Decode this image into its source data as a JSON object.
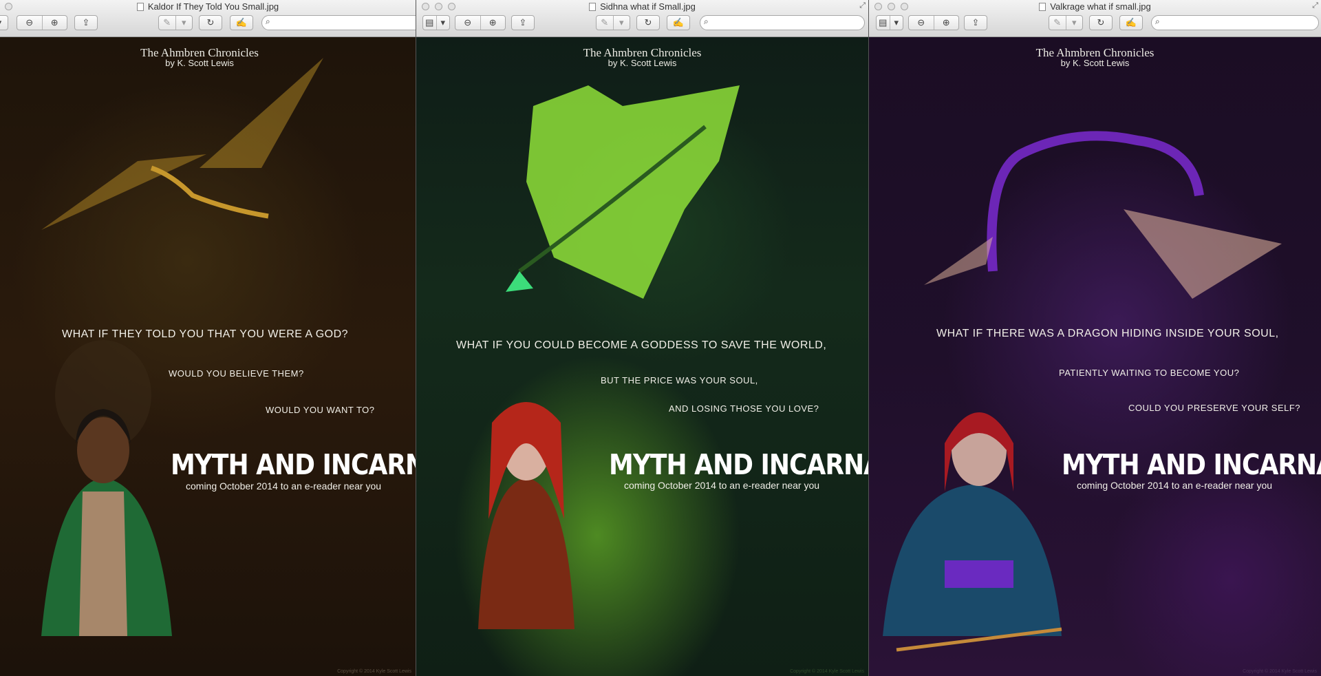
{
  "windows": [
    {
      "title": "Kaldor If They Told You Small.jpg",
      "series": "The Ahmbren Chronicles",
      "author": "by K. Scott Lewis",
      "lines": [
        "WHAT IF THEY TOLD YOU THAT YOU WERE A GOD?",
        "WOULD YOU BELIEVE THEM?",
        "WOULD YOU WANT TO?"
      ],
      "book": "MYTH AND INCARNATION",
      "coming": "coming October 2014 to an e-reader near you",
      "copyright": "Copyright © 2014 Kyle Scott Lewis"
    },
    {
      "title": "Sidhna what if Small.jpg",
      "series": "The Ahmbren Chronicles",
      "author": "by K. Scott Lewis",
      "lines": [
        "WHAT IF YOU COULD BECOME A GODDESS TO SAVE THE WORLD,",
        "BUT THE PRICE WAS YOUR SOUL,",
        "AND LOSING THOSE YOU LOVE?"
      ],
      "book": "MYTH AND INCARNATION",
      "coming": "coming October 2014 to an e-reader near you",
      "copyright": "Copyright © 2014 Kyle Scott Lewis"
    },
    {
      "title": "Valkrage what if small.jpg",
      "series": "The Ahmbren Chronicles",
      "author": "by K. Scott Lewis",
      "lines": [
        "WHAT IF THERE WAS A DRAGON HIDING INSIDE YOUR SOUL,",
        "PATIENTLY WAITING TO BECOME YOU?",
        "COULD YOU PRESERVE YOUR SELF?"
      ],
      "book": "MYTH AND INCARNATION",
      "coming": "coming October 2014 to an e-reader near you",
      "copyright": "Copyright © 2014 Kyle Scott Lewis"
    }
  ],
  "toolbar": {
    "zoom_out_icon": "⊖",
    "zoom_in_icon": "⊕",
    "share_icon": "⇪",
    "sidebar_icon": "▤",
    "pen_icon": "✎",
    "rotate_icon": "↻",
    "edit_icon": "✍",
    "search_icon": "⌕",
    "dropdown_icon": "▾",
    "fullscreen_icon": "⤢"
  },
  "colors": {
    "titlebar_top": "#f3f3f3",
    "titlebar_bottom": "#d6d6d6",
    "poster_text": "#f1efe8"
  }
}
